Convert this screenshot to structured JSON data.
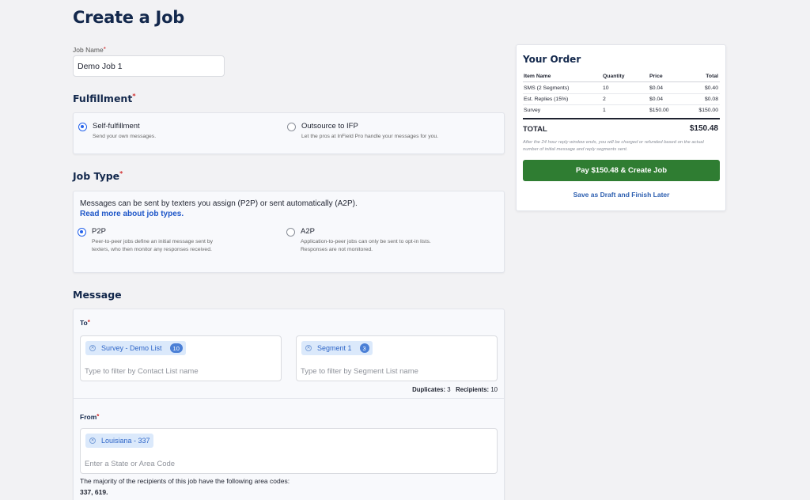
{
  "page": {
    "title": "Create a Job"
  },
  "job_name": {
    "label": "Job Name",
    "value": "Demo Job 1"
  },
  "fulfillment": {
    "title": "Fulfillment",
    "options": [
      {
        "label": "Self-fulfillment",
        "desc": "Send your own messages.",
        "selected": true
      },
      {
        "label": "Outsource to IFP",
        "desc": "Let the pros at InField Pro handle your messages for you.",
        "selected": false
      }
    ]
  },
  "job_type": {
    "title": "Job Type",
    "intro": "Messages can be sent by texters you assign (P2P) or sent automatically (A2P).",
    "link": "Read more about job types.",
    "options": [
      {
        "label": "P2P",
        "desc1": "Peer-to-peer jobs define an initial message sent by",
        "desc2": "texters, who then monitor any responses received.",
        "selected": true
      },
      {
        "label": "A2P",
        "desc1": "Application-to-peer jobs can only be sent to opt-in lists.",
        "desc2": "Responses are not monitored.",
        "selected": false
      }
    ]
  },
  "message": {
    "title": "Message",
    "to": {
      "label": "To",
      "contact_chip": {
        "label": "Survey - Demo List",
        "count": "10"
      },
      "contact_placeholder": "Type to filter by Contact List name",
      "segment_chip": {
        "label": "Segment 1",
        "count": "3"
      },
      "segment_placeholder": "Type to filter by Segment List name",
      "duplicates_label": "Duplicates:",
      "duplicates_value": "3",
      "recipients_label": "Recipients:",
      "recipients_value": "10"
    },
    "from": {
      "label": "From",
      "chip": {
        "label": "Louisiana - 337"
      },
      "placeholder": "Enter a State or Area Code",
      "note": "The majority of the recipients of this job have the following area codes:",
      "area_codes": "337, 619."
    }
  },
  "order": {
    "title": "Your Order",
    "headers": [
      "Item Name",
      "Quantity",
      "Price",
      "Total"
    ],
    "rows": [
      [
        "SMS (2 Segments)",
        "10",
        "$0.04",
        "$0.40"
      ],
      [
        "Est. Replies (15%)",
        "2",
        "$0.04",
        "$0.08"
      ],
      [
        "Survey",
        "1",
        "$150.00",
        "$150.00"
      ]
    ],
    "total_label": "TOTAL",
    "total_value": "$150.48",
    "fine_print": "After the 24 hour reply window ends, you will be charged or refunded based on the actual number of initial message and reply segments sent.",
    "pay_button": "Pay $150.48 & Create Job",
    "draft_link": "Save as Draft and Finish Later"
  },
  "colors": {
    "brand_navy": "#13284c",
    "accent_blue": "#2563eb",
    "pay_green": "#2f7d32",
    "required_red": "#d12b2b"
  }
}
